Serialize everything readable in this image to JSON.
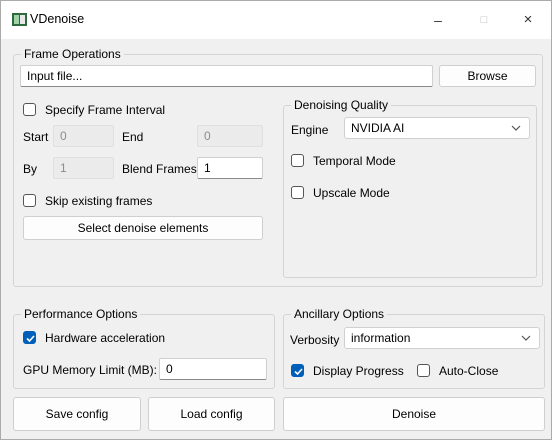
{
  "window": {
    "title": "VDenoise",
    "minimize_label": "–",
    "maximize_label": "□",
    "close_label": "×"
  },
  "frame_ops": {
    "title": "Frame Operations",
    "input_file": "Input file...",
    "browse": "Browse",
    "specify_interval": "Specify Frame Interval",
    "start_label": "Start",
    "start_value": "0",
    "end_label": "End",
    "end_value": "0",
    "by_label": "By",
    "by_value": "1",
    "blend_label": "Blend Frames",
    "blend_value": "1",
    "skip_existing": "Skip existing frames",
    "select_elements": "Select denoise elements"
  },
  "quality": {
    "title": "Denoising Quality",
    "engine_label": "Engine",
    "engine_value": "NVIDIA AI",
    "temporal": "Temporal Mode",
    "upscale": "Upscale Mode"
  },
  "performance": {
    "title": "Performance Options",
    "hw_accel": "Hardware acceleration",
    "gpu_label": "GPU Memory Limit (MB):",
    "gpu_value": "0"
  },
  "ancillary": {
    "title": "Ancillary Options",
    "verbosity_label": "Verbosity",
    "verbosity_value": "information",
    "display_progress": "Display Progress",
    "auto_close": "Auto-Close"
  },
  "actions": {
    "save": "Save config",
    "load": "Load config",
    "denoise": "Denoise"
  },
  "colors": {
    "accent": "#005fb8",
    "background": "#f0f0f0"
  }
}
